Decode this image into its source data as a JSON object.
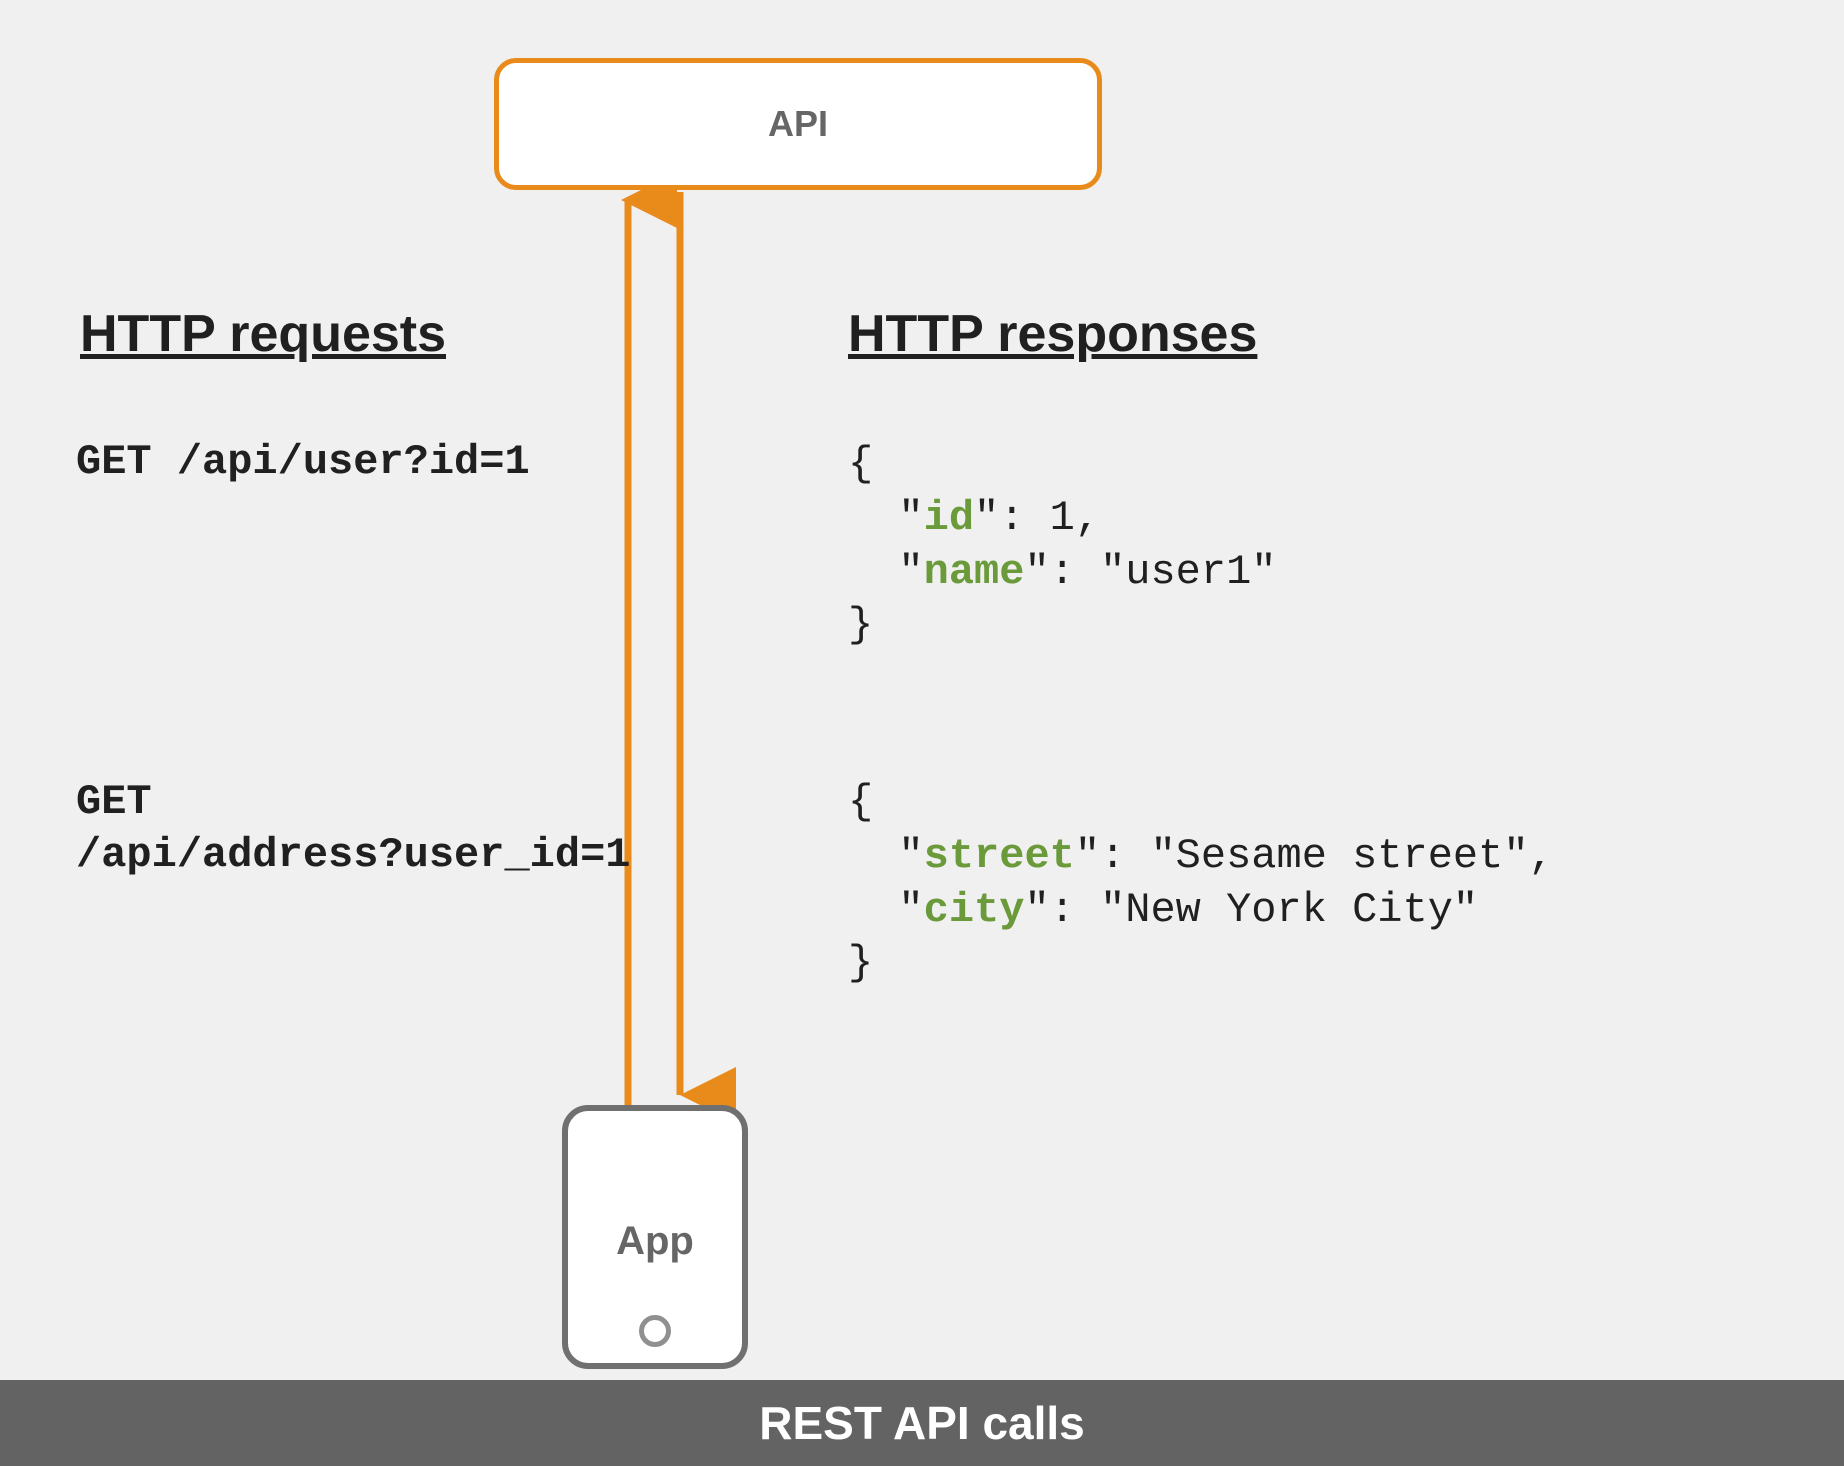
{
  "nodes": {
    "api_label": "API",
    "app_label": "App"
  },
  "headings": {
    "left": "HTTP requests",
    "right": "HTTP responses"
  },
  "requests": {
    "r1": "GET /api/user?id=1",
    "r2_line1": "GET",
    "r2_line2": "/api/address?user_id=1"
  },
  "responses": {
    "resp1": {
      "open": "{",
      "line1_pre": "  \"",
      "line1_key": "id",
      "line1_post": "\": 1,",
      "line2_pre": "  \"",
      "line2_key": "name",
      "line2_post": "\": \"user1\"",
      "close": "}"
    },
    "resp2": {
      "open": "{",
      "line1_pre": "  \"",
      "line1_key": "street",
      "line1_post": "\": \"Sesame street\",",
      "line2_pre": "  \"",
      "line2_key": "city",
      "line2_post": "\": \"New York City\"",
      "close": "}"
    }
  },
  "footer": "REST API calls",
  "colors": {
    "accent": "#e88b1a",
    "key_color": "#6a9a3a",
    "node_border": "#707070",
    "footer_bg": "#636363"
  }
}
